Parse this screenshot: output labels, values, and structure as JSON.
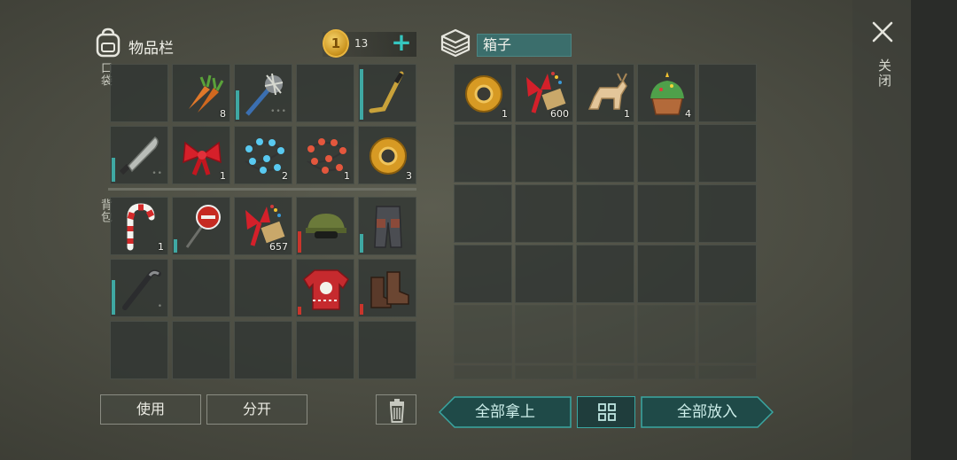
{
  "inventory": {
    "title": "物品栏",
    "coins": "13",
    "coin_symbol": "1",
    "pocket_label": "口袋",
    "backpack_label": "背包"
  },
  "box": {
    "title": "箱子"
  },
  "close_label": "关闭",
  "buttons": {
    "use": "使用",
    "split": "分开",
    "take_all": "全部拿上",
    "put_all": "全部放入"
  },
  "pocket_slots": [
    {
      "item": "",
      "qty": ""
    },
    {
      "item": "carrots-icon",
      "qty": "8"
    },
    {
      "item": "spiked-club-icon",
      "qty": "",
      "durability": 0.55,
      "dots": "•••"
    },
    {
      "item": "",
      "qty": ""
    },
    {
      "item": "hockey-stick-icon",
      "qty": "",
      "durability": 0.95
    },
    {
      "item": "machete-icon",
      "qty": "",
      "durability": 0.45,
      "dots": "••"
    },
    {
      "item": "red-bow-icon",
      "qty": "1"
    },
    {
      "item": "blue-lights-icon",
      "qty": "2"
    },
    {
      "item": "red-lights-icon",
      "qty": "1"
    },
    {
      "item": "tape-icon",
      "qty": "3"
    }
  ],
  "backpack_slots": [
    {
      "item": "candy-cane-icon",
      "qty": "1"
    },
    {
      "item": "stop-sign-icon",
      "qty": "",
      "durability": 0.25
    },
    {
      "item": "gift-ribbon-icon",
      "qty": "657"
    },
    {
      "item": "military-cap-icon",
      "qty": "",
      "durability": 0.4,
      "red": true
    },
    {
      "item": "armored-pants-icon",
      "qty": "",
      "durability": 0.35
    },
    {
      "item": "crowbar-icon",
      "qty": "",
      "durability": 0.65,
      "dots": "•"
    },
    {
      "item": "",
      "qty": ""
    },
    {
      "item": "",
      "qty": ""
    },
    {
      "item": "christmas-sweater-icon",
      "qty": "",
      "durability": 0.15,
      "red": true
    },
    {
      "item": "boots-icon",
      "qty": "",
      "durability": 0.2,
      "red": true
    },
    {
      "item": "",
      "qty": ""
    },
    {
      "item": "",
      "qty": ""
    },
    {
      "item": "",
      "qty": ""
    },
    {
      "item": "",
      "qty": ""
    },
    {
      "item": "",
      "qty": ""
    }
  ],
  "box_slots": [
    {
      "item": "tape-icon",
      "qty": "1"
    },
    {
      "item": "gift-ribbon-icon",
      "qty": "600"
    },
    {
      "item": "wooden-reindeer-icon",
      "qty": "1"
    },
    {
      "item": "christmas-cupcake-icon",
      "qty": "4"
    },
    {
      "item": "",
      "qty": ""
    }
  ],
  "colors": {
    "accent": "#3aa7a2",
    "durability": "#3fa8a3",
    "durability_low": "#c9352c"
  }
}
